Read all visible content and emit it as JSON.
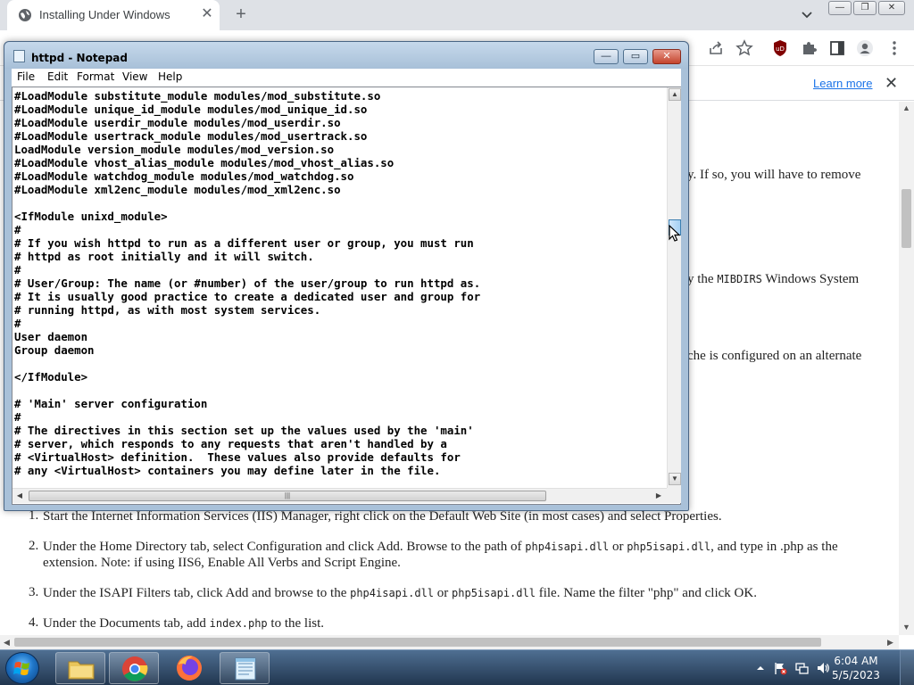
{
  "browser": {
    "tab_title": "Installing Under Windows",
    "new_tab_label": "+",
    "infobar_link": "Learn more"
  },
  "page": {
    "frag1": "y. If so, you will have to remove",
    "frag2_prefix": "y the ",
    "frag2_code": "MIBDIRS",
    "frag2_suffix": " Windows System",
    "frag3": "che is configured on an alternate",
    "list": [
      {
        "num": "1.",
        "text": "Start the Internet Information Services (IIS) Manager, right click on the Default Web Site (in most cases) and select Properties."
      },
      {
        "num": "2.",
        "text_a": "Under the Home Directory tab, select Configuration and click Add. Browse to the path of ",
        "code_a": "php4isapi.dll",
        "text_b": " or ",
        "code_b": "php5isapi.dll",
        "text_c": ", and type in .php as the",
        "text_d": "extension. Note: if using IIS6, Enable All Verbs and Script Engine."
      },
      {
        "num": "3.",
        "text_a": "Under the ISAPI Filters tab, click Add and browse to the ",
        "code_a": "php4isapi.dll",
        "text_b": " or ",
        "code_b": "php5isapi.dll",
        "text_c": " file. Name the filter \"php\" and click OK."
      },
      {
        "num": "4.",
        "text_a": "Under the Documents tab, add ",
        "code_a": "index.php",
        "text_b": " to the list."
      }
    ]
  },
  "notepad": {
    "title": "httpd - Notepad",
    "menu": [
      "File",
      "Edit",
      "Format",
      "View",
      "Help"
    ],
    "lines": [
      "#LoadModule substitute_module modules/mod_substitute.so",
      "#LoadModule unique_id_module modules/mod_unique_id.so",
      "#LoadModule userdir_module modules/mod_userdir.so",
      "#LoadModule usertrack_module modules/mod_usertrack.so",
      "LoadModule version_module modules/mod_version.so",
      "#LoadModule vhost_alias_module modules/mod_vhost_alias.so",
      "#LoadModule watchdog_module modules/mod_watchdog.so",
      "#LoadModule xml2enc_module modules/mod_xml2enc.so",
      "",
      "<IfModule unixd_module>",
      "#",
      "# If you wish httpd to run as a different user or group, you must run",
      "# httpd as root initially and it will switch.",
      "#",
      "# User/Group: The name (or #number) of the user/group to run httpd as.",
      "# It is usually good practice to create a dedicated user and group for",
      "# running httpd, as with most system services.",
      "#",
      "User daemon",
      "Group daemon",
      "",
      "</IfModule>",
      "",
      "# 'Main' server configuration",
      "#",
      "# The directives in this section set up the values used by the 'main'",
      "# server, which responds to any requests that aren't handled by a",
      "# <VirtualHost> definition.  These values also provide defaults for",
      "# any <VirtualHost> containers you may define later in the file."
    ]
  },
  "taskbar": {
    "time": "6:04 AM",
    "date": "5/5/2023"
  },
  "colors": {
    "link": "#1a73e8",
    "taskbar": "#2c4766",
    "notepad_frame": "#a9c1d9"
  }
}
